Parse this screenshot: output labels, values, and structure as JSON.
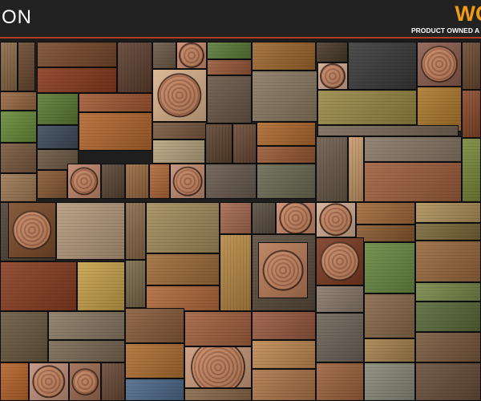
{
  "header": {
    "title_partial": "ON",
    "brand_partial": "WO",
    "tagline_partial": "PRODUCT OWNED A",
    "accent_color": "#f29a12",
    "rule_color": "#b73a24"
  },
  "mosaic": {
    "description_icon": "wood-photo-collage"
  }
}
